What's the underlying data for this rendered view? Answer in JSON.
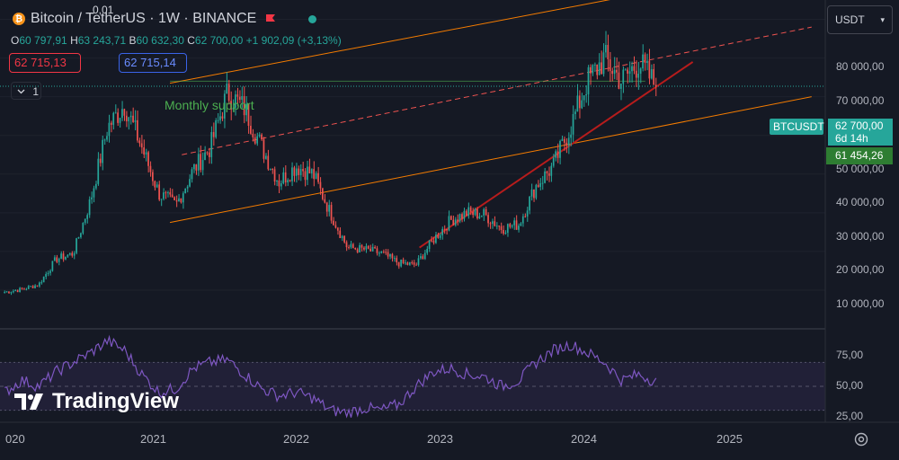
{
  "header": {
    "title": "Bitcoin / TetherUS · 1W · BINANCE",
    "coin_icon": "bitcoin-icon",
    "flag_icon": "flag-icon",
    "status_dot_icon": "market-open-dot-icon"
  },
  "ohlc": {
    "o_label": "O",
    "o_value": "60 797,91",
    "h_label": "H",
    "h_value": "63 243,71",
    "b_label": "B",
    "b_value": "60 632,30",
    "c_label": "C",
    "c_value": "62 700,00",
    "change": "+1 902,09 (+3,13%)"
  },
  "trade": {
    "bid": "62 715,13",
    "spread": "0,01",
    "ask": "62 715,14"
  },
  "indicators": {
    "count": "1",
    "toggle_icon": "chevron-down-icon"
  },
  "currency": {
    "label": "USDT",
    "icon": "chevron-down-icon"
  },
  "price_scale": {
    "labels": [
      "80 000,00",
      "70 000,00",
      "60 000,00",
      "50 000,00",
      "40 000,00",
      "30 000,00",
      "20 000,00",
      "10 000,00"
    ]
  },
  "rsi_scale": {
    "labels": [
      "75,00",
      "50,00",
      "25,00"
    ]
  },
  "time_scale": {
    "labels": [
      "020",
      "2021",
      "2022",
      "2023",
      "2024",
      "2025"
    ]
  },
  "tags": {
    "symbol": "BTCUSDT",
    "last_price": "62 700,00",
    "countdown": "6d 14h",
    "position": "61 454,26"
  },
  "annotation": {
    "text": "Monthly support"
  },
  "branding": {
    "name": "TradingView",
    "logo_icon": "tradingview-logo-icon"
  },
  "settings": {
    "icon": "gear-icon"
  },
  "colors": {
    "up": "#26a69a",
    "down": "#ef5350",
    "channel": "#f57c00",
    "trendline": "#b71c1c",
    "rsi": "#7e57c2",
    "background": "#151924"
  },
  "chart_data": [
    {
      "type": "candlestick",
      "series": [
        {
          "name": "BTCUSDT",
          "interval": "1W",
          "close": [
            9500,
            10200,
            11500,
            18000,
            19500,
            33000,
            52000,
            58000,
            47000,
            35000,
            32000,
            41000,
            47000,
            61000,
            57000,
            47000,
            38000,
            42000,
            40000,
            30000,
            21000,
            20500,
            19500,
            17000,
            16500,
            23000,
            28000,
            30000,
            29500,
            26000,
            27000,
            37000,
            42000,
            52000,
            64000,
            70000,
            64000,
            69000,
            62700
          ],
          "close_approx": true
        }
      ],
      "ylim": [
        0,
        85000
      ],
      "xlim": [
        "2019-12",
        "2025-09"
      ],
      "trendlines": [
        {
          "name": "channel-upper",
          "points": [
            [
              "2021-02",
              63500
            ],
            [
              "2025-08",
              95000
            ]
          ]
        },
        {
          "name": "channel-lower",
          "points": [
            [
              "2021-02",
              27500
            ],
            [
              "2025-08",
              60000
            ]
          ]
        },
        {
          "name": "channel-mid-dashed",
          "points": [
            [
              "2021-03",
              45000
            ],
            [
              "2025-08",
              78000
            ]
          ]
        },
        {
          "name": "support-rising",
          "points": [
            [
              "2022-11",
              21000
            ],
            [
              "2024-10",
              69000
            ]
          ]
        },
        {
          "name": "monthly-support",
          "points": [
            [
              "2021-02",
              64000
            ],
            [
              "2024-06",
              64000
            ]
          ]
        }
      ]
    },
    {
      "type": "line",
      "series": [
        {
          "name": "RSI",
          "values": [
            45,
            55,
            50,
            62,
            70,
            78,
            88,
            80,
            60,
            45,
            48,
            65,
            70,
            72,
            60,
            48,
            42,
            45,
            40,
            30,
            28,
            32,
            30,
            35,
            50,
            62,
            65,
            60,
            58,
            50,
            55,
            70,
            80,
            85,
            78,
            70,
            55,
            60,
            54
          ]
        }
      ],
      "ylim": [
        20,
        95
      ],
      "levels": [
        70,
        50,
        30
      ]
    }
  ]
}
